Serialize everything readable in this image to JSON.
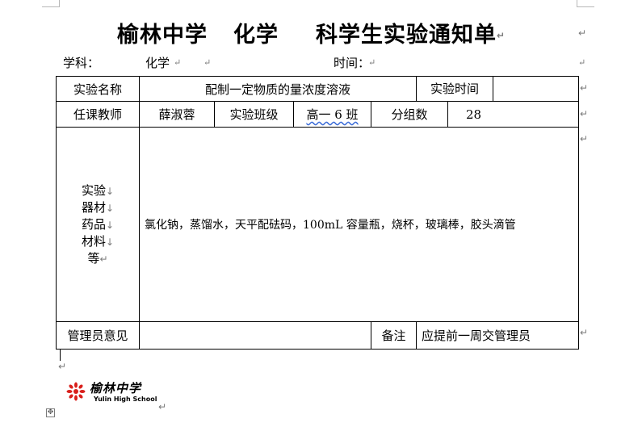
{
  "document": {
    "title": {
      "school": "榆林中学",
      "subject": "化学",
      "name": "科学生实验通知单"
    },
    "subject_label": "学科：",
    "subject_value": "化学",
    "time_label": "时间：",
    "table": {
      "row1": {
        "name_label": "实验名称",
        "name_value": "配制一定物质的量浓度溶液",
        "time_label": "实验时间",
        "time_value": ""
      },
      "row2": {
        "teacher_label": "任课教师",
        "teacher_value": "薛淑蓉",
        "class_label": "实验班级",
        "class_value": "高一 6 班",
        "groups_label": "分组数",
        "groups_value": "28"
      },
      "row3": {
        "label_lines": [
          "实验",
          "器材",
          "药品",
          "材料",
          "等"
        ],
        "materials": "氯化钠，蒸馏水，天平配砝码，100mL 容量瓶，烧杯，玻璃棒，胶头滴管"
      },
      "row4": {
        "admin_label": "管理员意见",
        "admin_value": "",
        "note_label": "备注",
        "note_value": "应提前一周交管理员"
      }
    },
    "logo": {
      "name": "榆林中学",
      "subtitle": "Yulin High School",
      "colors": {
        "brand": "#d9201c"
      }
    },
    "paragraph_mark": "↵",
    "line_mark": "↓"
  }
}
